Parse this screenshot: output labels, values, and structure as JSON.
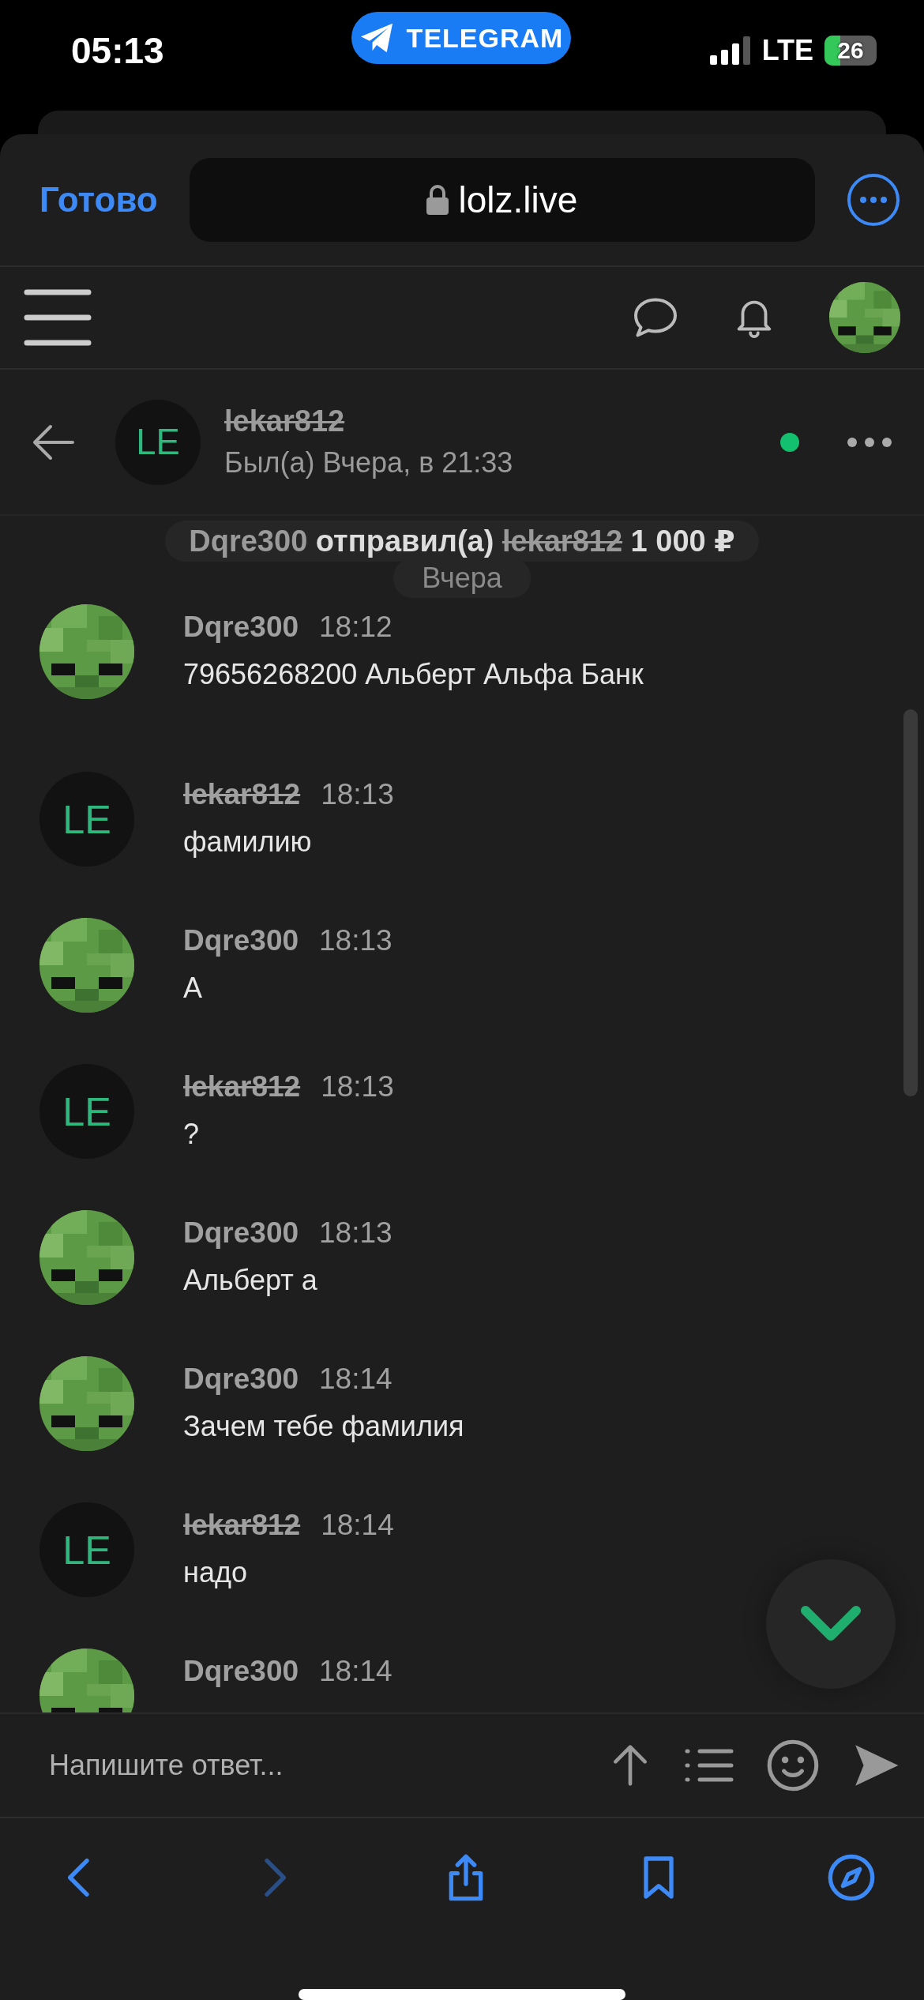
{
  "status_bar": {
    "time": "05:13",
    "app_pill": "TELEGRAM",
    "network": "LTE",
    "battery": "26"
  },
  "browser": {
    "done_button": "Готово",
    "url": "lolz.live"
  },
  "chat_header": {
    "avatar": {
      "kind": "initials",
      "initials": "LE"
    },
    "name": "lekar812",
    "name_struck": true,
    "last_seen": "Был(а) Вчера, в 21:33",
    "online": true
  },
  "system_message": {
    "sender": "Dqre300",
    "action": "отправил(а)",
    "recipient": "lekar812",
    "recipient_struck": true,
    "amount": "1 000 ₽"
  },
  "date_separator": "Вчера",
  "messages": [
    {
      "author": "Dqre300",
      "author_struck": false,
      "time": "18:12",
      "text": "79656268200 Альберт Альфа Банк"
    },
    {
      "author": "lekar812",
      "author_struck": true,
      "avatar": {
        "kind": "initials",
        "initials": "LE"
      },
      "time": "18:13",
      "text": "фамилию"
    },
    {
      "author": "Dqre300",
      "author_struck": false,
      "time": "18:13",
      "text": "А"
    },
    {
      "author": "lekar812",
      "author_struck": true,
      "avatar": {
        "kind": "initials",
        "initials": "LE"
      },
      "time": "18:13",
      "text": "?"
    },
    {
      "author": "Dqre300",
      "author_struck": false,
      "time": "18:13",
      "text": "Альберт а"
    },
    {
      "author": "Dqre300",
      "author_struck": false,
      "time": "18:14",
      "text": "Зачем тебе фамилия"
    },
    {
      "author": "lekar812",
      "author_struck": true,
      "avatar": {
        "kind": "initials",
        "initials": "LE"
      },
      "time": "18:14",
      "text": "надо"
    },
    {
      "author": "Dqre300",
      "author_struck": false,
      "time": "18:14"
    }
  ],
  "composer": {
    "placeholder": "Напишите ответ..."
  },
  "browser_toolbar": [
    {
      "kind": "back",
      "disabled": false
    },
    {
      "kind": "forward",
      "disabled": true
    },
    {
      "kind": "share",
      "disabled": false
    },
    {
      "kind": "bookmarks",
      "disabled": false
    },
    {
      "kind": "compass",
      "disabled": false
    }
  ]
}
